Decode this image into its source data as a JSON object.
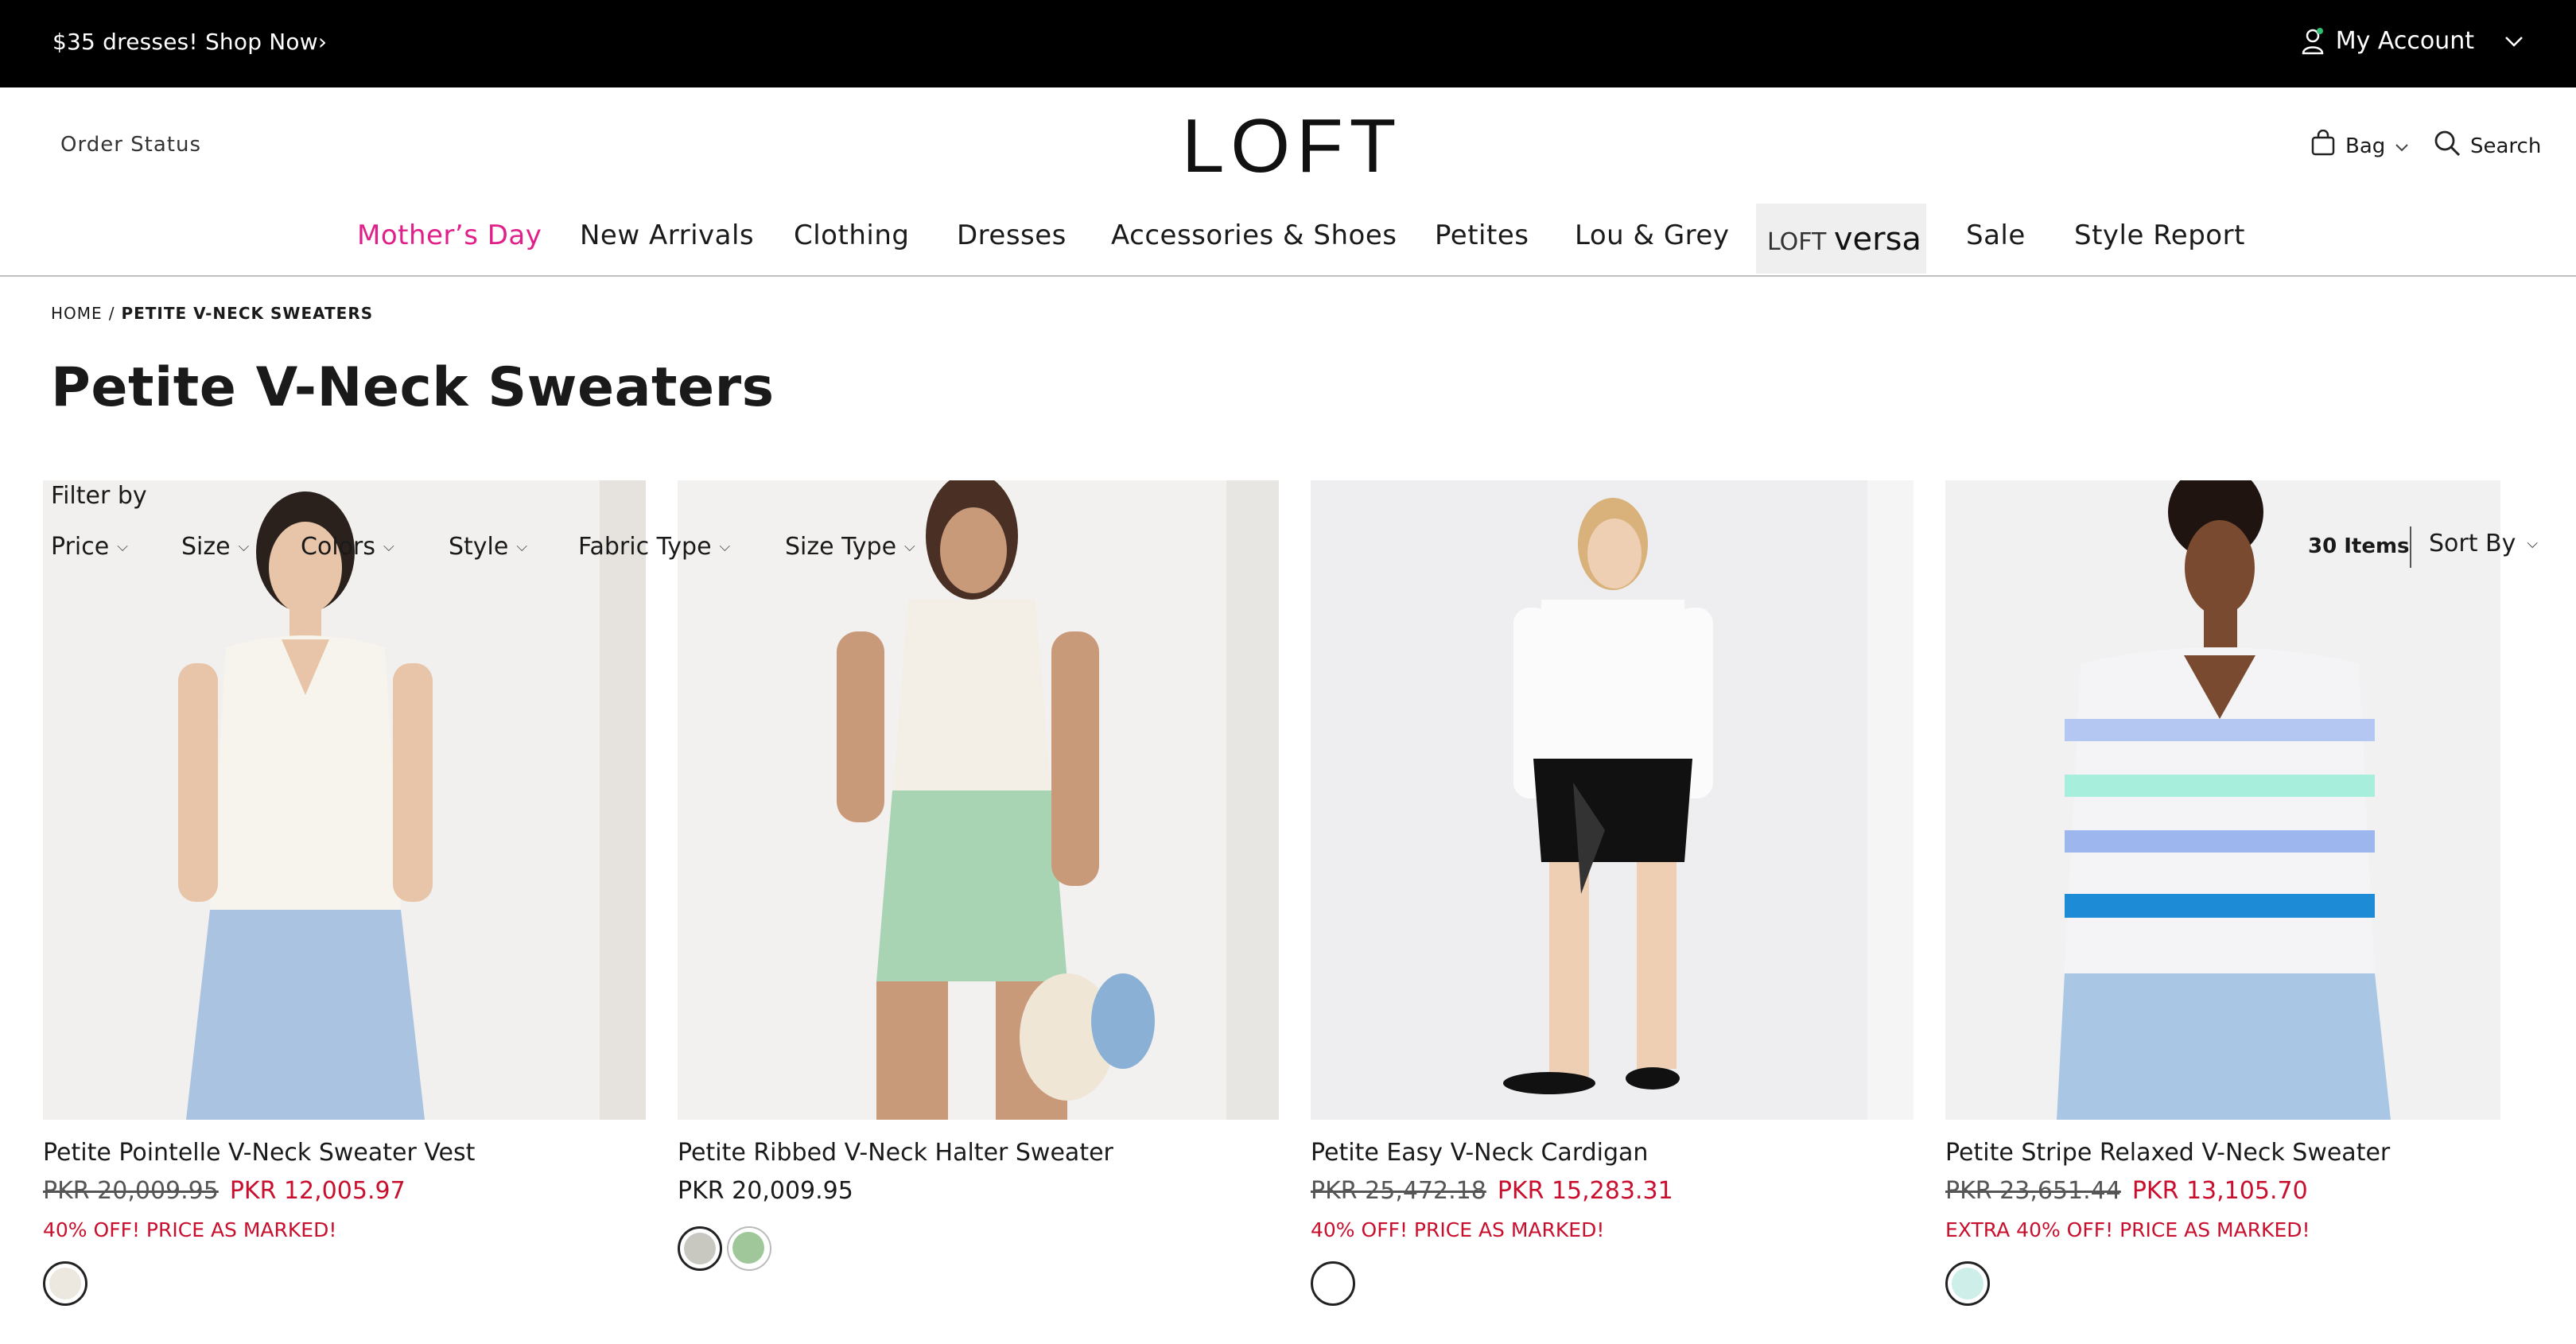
{
  "promo_bar": {
    "text": "$35 dresses!  Shop Now›",
    "account_label": "My Account"
  },
  "header": {
    "order_status": "Order Status",
    "logo": "LOFT",
    "bag_label": "Bag",
    "search_label": "Search"
  },
  "nav": {
    "items": [
      "Mother’s Day",
      "New Arrivals",
      "Clothing",
      "Dresses",
      "Accessories & Shoes",
      "Petites",
      "Lou & Grey",
      "Sale",
      "Style Report"
    ],
    "versa_prefix": "LOFT",
    "versa_word": "versa"
  },
  "breadcrumb": {
    "home": "HOME",
    "separator": "/",
    "current": "PETITE V-NECK SWEATERS"
  },
  "page_title": "Petite V-Neck Sweaters",
  "filters": {
    "label": "Filter by",
    "items": [
      "Price",
      "Size",
      "Colors",
      "Style",
      "Fabric Type",
      "Size Type"
    ],
    "item_count": "30 Items",
    "sort_label": "Sort By"
  },
  "products": [
    {
      "name": "Petite Pointelle V-Neck Sweater Vest",
      "original_price": "PKR 20,009.95",
      "sale_price": "PKR 12,005.97",
      "promo": "40% OFF! PRICE AS MARKED!",
      "swatches": [
        "#ece7df"
      ]
    },
    {
      "name": "Petite Ribbed V-Neck Halter Sweater",
      "original_price": "",
      "sale_price": "PKR 20,009.95",
      "promo": "",
      "swatches": [
        "#c9c8c0",
        "#9fc79a"
      ]
    },
    {
      "name": "Petite Easy V-Neck Cardigan",
      "original_price": "PKR 25,472.18",
      "sale_price": "PKR 15,283.31",
      "promo": "40% OFF! PRICE AS MARKED!",
      "swatches": [
        "#ffffff"
      ]
    },
    {
      "name": "Petite Stripe Relaxed V-Neck Sweater",
      "original_price": "PKR 23,651.44",
      "sale_price": "PKR 13,105.70",
      "promo": "EXTRA 40% OFF! PRICE AS MARKED!",
      "swatches": [
        "#cdeee9"
      ]
    }
  ],
  "colors": {
    "pink_nav": "#e0208a",
    "sale_red": "#c8102e"
  }
}
